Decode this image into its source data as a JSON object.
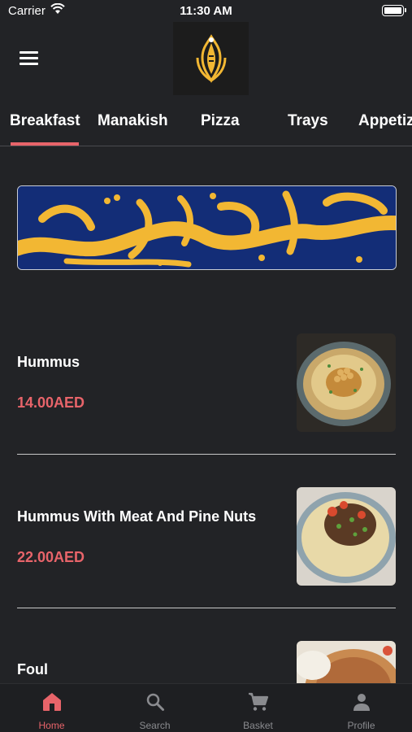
{
  "status_bar": {
    "carrier": "Carrier",
    "time": "11:30 AM"
  },
  "tabs": [
    {
      "label": "Breakfast"
    },
    {
      "label": "Manakish"
    },
    {
      "label": "Pizza"
    },
    {
      "label": "Trays"
    },
    {
      "label": "Appetiz"
    }
  ],
  "banner": {
    "alt_theme": "ramadan-kareem-calligraphy"
  },
  "items": [
    {
      "name": "Hummus",
      "price": "14.00AED"
    },
    {
      "name": "Hummus With Meat And Pine Nuts",
      "price": "22.00AED"
    },
    {
      "name": "Foul",
      "price": ""
    }
  ],
  "bottom_nav": [
    {
      "label": "Home",
      "icon": "home-icon"
    },
    {
      "label": "Search",
      "icon": "search-icon"
    },
    {
      "label": "Basket",
      "icon": "cart-icon"
    },
    {
      "label": "Profile",
      "icon": "person-icon"
    }
  ],
  "colors": {
    "accent": "#e8646a",
    "background": "#222326",
    "banner_bg": "#132d77",
    "banner_gold": "#f2b733"
  }
}
